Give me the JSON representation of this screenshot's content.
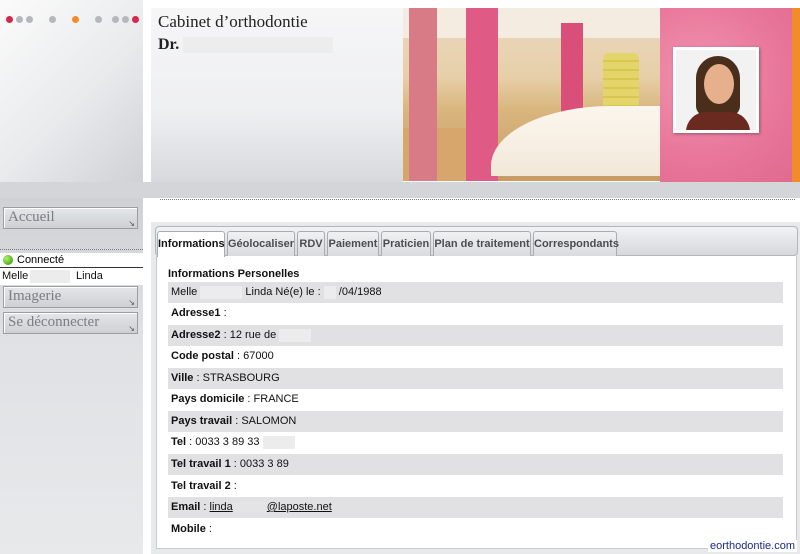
{
  "header": {
    "title": "Cabinet d’orthodontie",
    "doctor_prefix": "Dr."
  },
  "sidebar": {
    "accueil": "Accueil",
    "status": "Connecté",
    "user_title": "Melle",
    "user_first_name": "Linda",
    "imagerie": "Imagerie",
    "deconnecter": "Se déconnecter"
  },
  "tabs": [
    {
      "label": "Informations"
    },
    {
      "label": "Géolocaliser"
    },
    {
      "label": "RDV"
    },
    {
      "label": "Paiement"
    },
    {
      "label": "Praticien"
    },
    {
      "label": "Plan de traitement"
    },
    {
      "label": "Correspondants"
    }
  ],
  "info": {
    "heading": "Informations Personelles",
    "title": "Melle",
    "first_name": "Linda",
    "born_label": "Né(e) le :",
    "birth_date": "/04/1988",
    "adresse1_label": "Adresse1",
    "adresse1_value": "",
    "adresse2_label": "Adresse2",
    "adresse2_value": "12 rue de",
    "cp_label": "Code postal",
    "cp_value": "67000",
    "ville_label": "Ville",
    "ville_value": "STRASBOURG",
    "pays_dom_label": "Pays domicile",
    "pays_dom_value": "FRANCE",
    "pays_trav_label": "Pays travail",
    "pays_trav_value": "SALOMON",
    "tel_label": "Tel",
    "tel_value": "0033 3 89 33",
    "tel1_label": "Tel travail 1",
    "tel1_value": "0033 3 89",
    "tel2_label": "Tel travail 2",
    "tel2_value": "",
    "email_label": "Email",
    "email_user": "linda",
    "email_domain": "@laposte.net",
    "mobile_label": "Mobile",
    "mobile_value": ""
  },
  "footer": {
    "brand": "eorthodontie.com"
  },
  "colors": {
    "accent_pink": "#e8769a",
    "accent_orange": "#f28c2a",
    "status_green": "#46b01a",
    "row_shade": "#e1e1e3"
  }
}
